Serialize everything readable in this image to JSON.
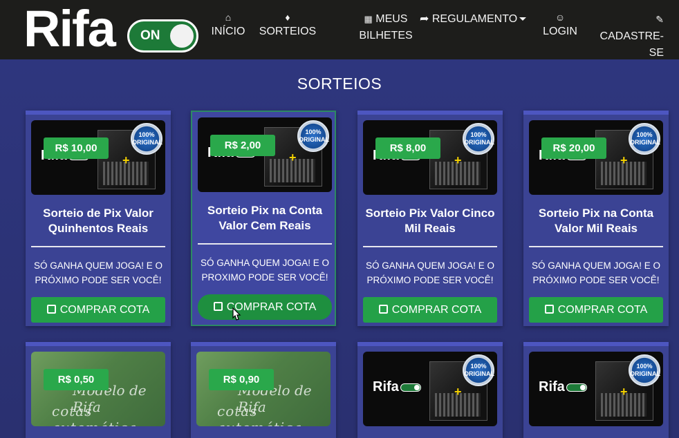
{
  "header": {
    "logo_text": "Rifa",
    "toggle_label": "ON",
    "nav": [
      {
        "icon": "home-icon",
        "label": "INÍCIO"
      },
      {
        "icon": "ticket-icon",
        "label": "SORTEIOS"
      },
      {
        "icon": "grid-icon",
        "label_line1": "MEUS",
        "label_line2": "BILHETES"
      },
      {
        "icon": "share-icon",
        "label": "REGULAMENTO"
      },
      {
        "icon": "user-icon",
        "label": "LOGIN"
      },
      {
        "icon": "edit-icon",
        "label_line1": "CADASTRE-",
        "label_line2": "SE"
      }
    ]
  },
  "page": {
    "title": "SORTEIOS"
  },
  "cards": [
    {
      "price": "R$ 10,00",
      "title": "Sorteio de Pix Valor Quinhentos Reais",
      "desc": "SÓ GANHA QUEM JOGA! E O PRÓXIMO PODE SER VOCÊ!",
      "button": "COMPRAR COTA"
    },
    {
      "price": "R$ 2,00",
      "title": "Sorteio Pix na Conta Valor Cem Reais",
      "desc": "SÓ GANHA QUEM JOGA! E O PROXIMO PODE SER VOCÊ!",
      "button": "COMPRAR COTA"
    },
    {
      "price": "R$ 8,00",
      "title": "Sorteio Pix Valor Cinco Mil Reais",
      "desc": "SÓ GANHA QUEM JOGA! E O PRÓXIMO PODE SER VOCÊ!",
      "button": "COMPRAR COTA"
    },
    {
      "price": "R$ 20,00",
      "title": "Sorteio Pix na Conta Valor Mil Reais",
      "desc": "SÓ GANHA QUEM JOGA! E O PRÓXIMO PODE SER VOCÊ!",
      "button": "COMPRAR COTA"
    },
    {
      "price": "R$ 0,50",
      "thumb_line1": "Modelo de Rifa",
      "thumb_line2": "cotas automática"
    },
    {
      "price": "R$ 0,90",
      "thumb_line1": "Modelo de Rifa",
      "thumb_line2": "cotas automática"
    },
    {
      "thumb_logo": "Rifa"
    },
    {
      "thumb_logo": "Rifa"
    }
  ],
  "thumb_logo_text": "Rifa",
  "seal_text": "100% ORIGINAL",
  "colors": {
    "navbar": "#1d1d1b",
    "page_bg": "#2d3470",
    "card_bg": "#3b4394",
    "accent_green": "#24a148"
  }
}
